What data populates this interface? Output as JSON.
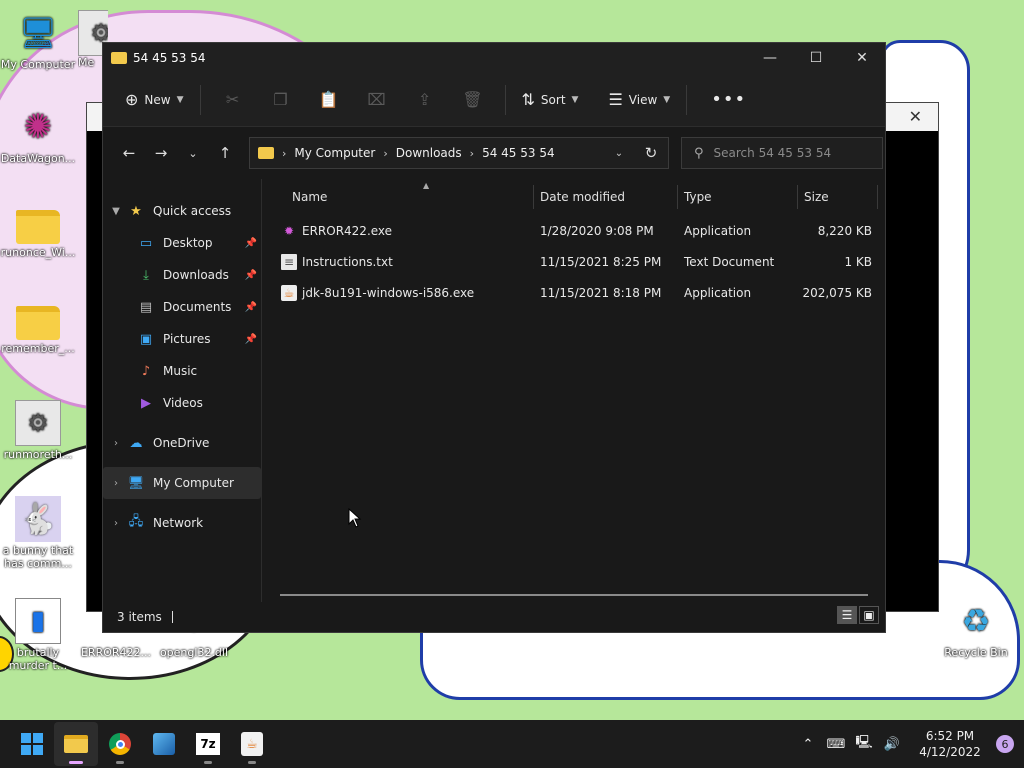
{
  "desktop": {
    "icons": [
      {
        "label": "My Computer"
      },
      {
        "label": "Me"
      },
      {
        "label": "DataWagon..."
      },
      {
        "label": "runonce_Wi..."
      },
      {
        "label": "remember_..."
      },
      {
        "label": "runmoreth..."
      },
      {
        "label": "a bunny that has comm..."
      },
      {
        "label": "brutally murder t..."
      },
      {
        "label": "ERROR422..."
      },
      {
        "label": "opengl32.dll"
      },
      {
        "label": "Recycle Bin"
      }
    ]
  },
  "window": {
    "title": "54 45 53 54",
    "controls": {
      "minimize": "—",
      "maximize": "☐",
      "close": "✕"
    }
  },
  "toolbar": {
    "new_label": "New",
    "sort_label": "Sort",
    "view_label": "View",
    "more_label": "•••"
  },
  "address": {
    "crumbs": [
      "My Computer",
      "Downloads",
      "54 45 53 54"
    ],
    "search_placeholder": "Search 54 45 53 54"
  },
  "navpane": {
    "quick_access": "Quick access",
    "items": [
      {
        "label": "Desktop"
      },
      {
        "label": "Downloads"
      },
      {
        "label": "Documents"
      },
      {
        "label": "Pictures"
      },
      {
        "label": "Music"
      },
      {
        "label": "Videos"
      }
    ],
    "onedrive": "OneDrive",
    "my_computer": "My Computer",
    "network": "Network"
  },
  "files": {
    "columns": {
      "name": "Name",
      "date": "Date modified",
      "type": "Type",
      "size": "Size"
    },
    "rows": [
      {
        "name": "ERROR422.exe",
        "date": "1/28/2020 9:08 PM",
        "type": "Application",
        "size": "8,220 KB"
      },
      {
        "name": "Instructions.txt",
        "date": "11/15/2021 8:25 PM",
        "type": "Text Document",
        "size": "1 KB"
      },
      {
        "name": "jdk-8u191-windows-i586.exe",
        "date": "11/15/2021 8:18 PM",
        "type": "Application",
        "size": "202,075 KB"
      }
    ]
  },
  "status": {
    "items_count": "3 items"
  },
  "taskbar": {
    "zip_label": "7z",
    "clock_time": "6:52 PM",
    "clock_date": "4/12/2022",
    "notification_count": "6"
  }
}
